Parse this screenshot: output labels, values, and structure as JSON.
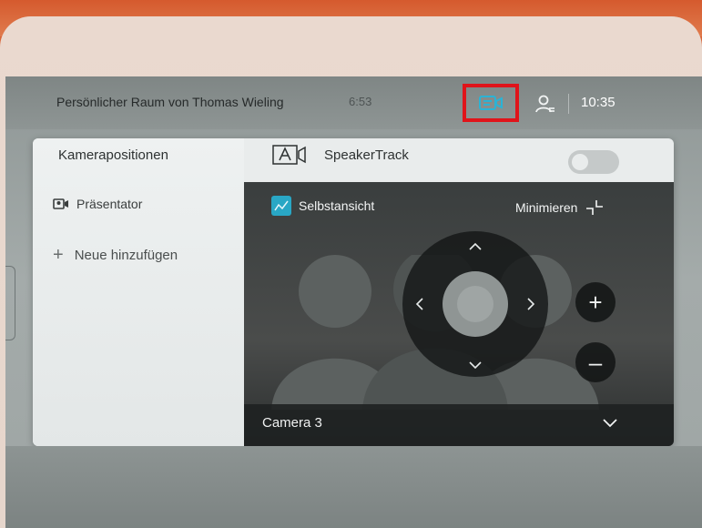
{
  "status_bar": {
    "room_title": "Persönlicher Raum von Thomas Wieling",
    "timer": "6:53",
    "clock": "10:35"
  },
  "camera_panel": {
    "presets_heading": "Kamerapositionen",
    "preset_presenter": "Präsentator",
    "add_new": "Neue hinzufügen",
    "speakertrack_label": "SpeakerTrack",
    "speakertrack_enabled": false,
    "selfview_label": "Selbstansicht",
    "minimize_label": "Minimieren",
    "zoom_in_symbol": "+",
    "zoom_out_symbol": "–",
    "camera_name": "Camera 3"
  },
  "icons": {
    "presence": "camera-presence-icon",
    "user": "user-icon",
    "presenter_preset": "presenter-icon",
    "speakertrack": "speakertrack-icon",
    "selfview": "selfview-checkbox-icon",
    "minimize": "minimize-icon",
    "camera_dropdown": "chevron-down-icon"
  },
  "colors": {
    "highlight_box": "#e0141a",
    "selfview_accent": "#29a7c5",
    "panel_bg": "#e9ecec",
    "selfview_bg": "#3a3e3e"
  }
}
